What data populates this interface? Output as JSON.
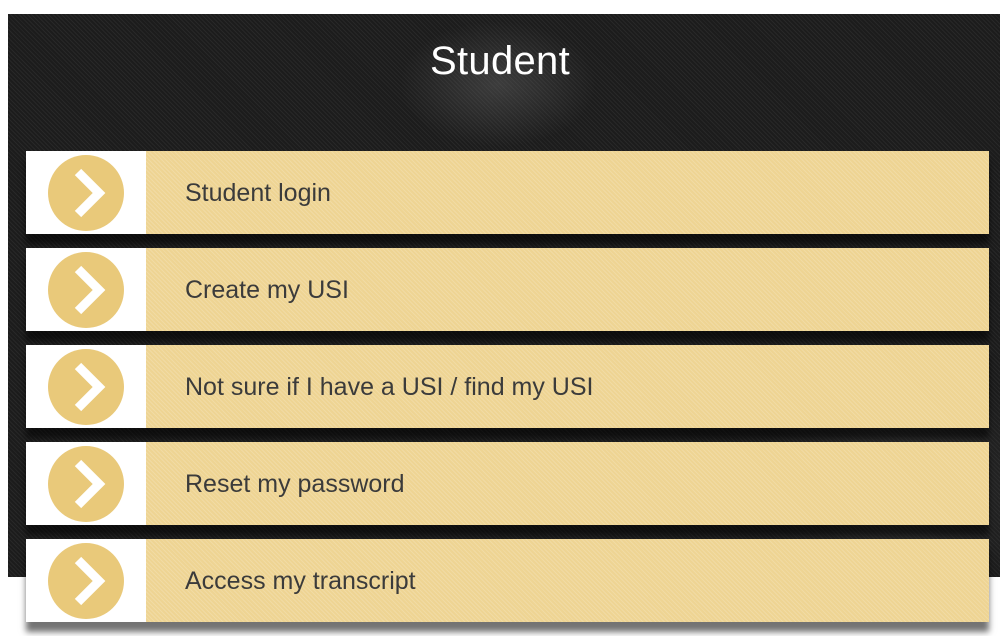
{
  "page": {
    "title": "Student"
  },
  "menu": {
    "items": [
      {
        "label": "Student login",
        "icon": "chevron-right-circle-icon"
      },
      {
        "label": "Create my USI",
        "icon": "chevron-right-circle-icon"
      },
      {
        "label": "Not sure if I have a USI / find my USI",
        "icon": "chevron-right-circle-icon"
      },
      {
        "label": "Reset my password",
        "icon": "chevron-right-circle-icon"
      },
      {
        "label": "Access my transcript",
        "icon": "chevron-right-circle-icon"
      }
    ]
  },
  "colors": {
    "item_background": "#eed493",
    "icon_circle": "#e9c97a",
    "icon_background": "#ffffff",
    "label_text": "#3b3b3b",
    "header_background": "#1c1c1c",
    "title_text": "#ffffff"
  }
}
